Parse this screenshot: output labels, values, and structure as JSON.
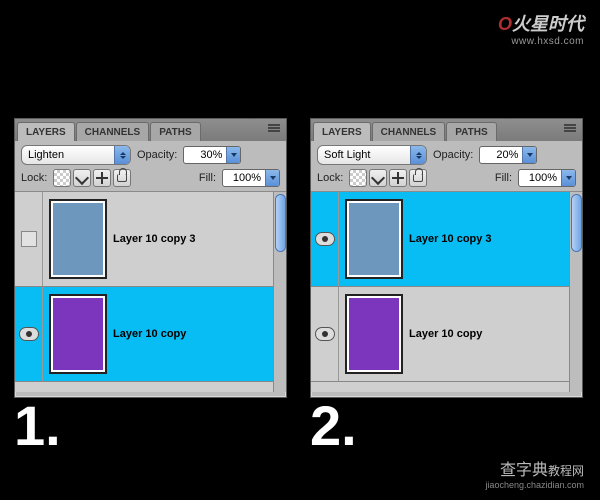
{
  "watermarks": {
    "top_logo_text": "火星时代",
    "top_url": "www.hxsd.com",
    "bottom_text": "查字典",
    "bottom_suffix": "教程网",
    "bottom_url": "jiaocheng.chazidian.com"
  },
  "tabs": {
    "layers": "LAYERS",
    "channels": "CHANNELS",
    "paths": "PATHS"
  },
  "labels": {
    "opacity": "Opacity:",
    "lock": "Lock:",
    "fill": "Fill:"
  },
  "panel1": {
    "blend_mode": "Lighten",
    "opacity": "30%",
    "fill": "100%",
    "layers": [
      {
        "name": "Layer 10 copy 3",
        "selected": false,
        "visible": false,
        "color": "blue"
      },
      {
        "name": "Layer 10 copy",
        "selected": true,
        "visible": true,
        "color": "purple"
      }
    ],
    "label": "1."
  },
  "panel2": {
    "blend_mode": "Soft Light",
    "opacity": "20%",
    "fill": "100%",
    "layers": [
      {
        "name": "Layer 10 copy 3",
        "selected": true,
        "visible": true,
        "color": "blue"
      },
      {
        "name": "Layer 10 copy",
        "selected": false,
        "visible": true,
        "color": "purple"
      }
    ],
    "label": "2."
  }
}
